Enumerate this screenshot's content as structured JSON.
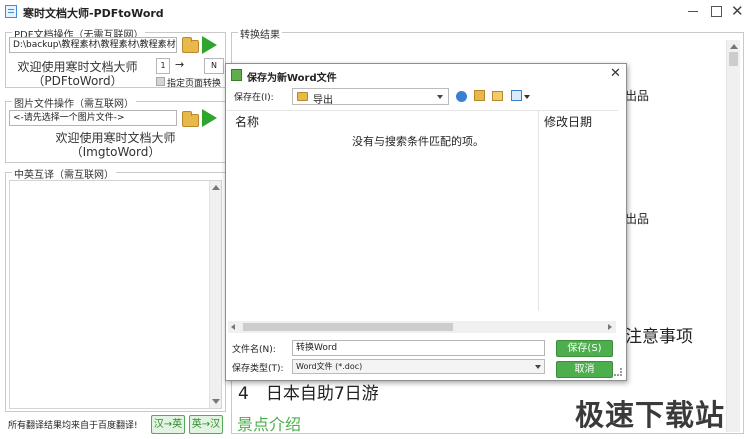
{
  "app": {
    "title": "寒时文档大师-PDFtoWord"
  },
  "pdf_group": {
    "title": "PDF文档操作（无需互联网）",
    "path": "D:\\backup\\教程素材\\教程素材\\教程素材",
    "welcome_line1": "欢迎使用寒时文档大师",
    "welcome_line2": "（PDFtoWord）",
    "page_from": "1",
    "arrow": "→",
    "page_to": "N",
    "specify_pages_label": "指定页面转换"
  },
  "image_group": {
    "title": "图片文件操作（需互联网）",
    "path_placeholder": "<-请先选择一个图片文件->",
    "welcome_line1": "欢迎使用寒时文档大师",
    "welcome_line2": "（ImgtoWord）"
  },
  "translate_group": {
    "title": "中英互译（需互联网）",
    "footer_note": "所有翻译结果均来自于百度翻译!",
    "zh_to_en": "汉→英",
    "en_to_zh": "英→汉"
  },
  "result_group": {
    "title": "转换结果",
    "lines": [
      {
        "text": "出品"
      },
      {
        "text": "出品"
      },
      {
        "text": "注意事项"
      },
      {
        "text": "4　日本自助7日游"
      },
      {
        "text": "景点介绍"
      }
    ]
  },
  "dialog": {
    "title": "保存为新Word文件",
    "save_in_label": "保存在(I):",
    "save_in_value": "导出",
    "col_name": "名称",
    "col_modified": "修改日期",
    "empty_message": "没有与搜索条件匹配的项。",
    "filename_label": "文件名(N):",
    "filename_value": "转换Word",
    "filetype_label": "保存类型(T):",
    "filetype_value": "Word文件 (*.doc)",
    "save_button": "保存(S)",
    "cancel_button": "取消"
  },
  "watermark": {
    "text": "极速下载站"
  },
  "colors": {
    "accent_green": "#4cae4c",
    "title_bar": "#ffffff",
    "dialog_title_bg": "#ffffff"
  }
}
